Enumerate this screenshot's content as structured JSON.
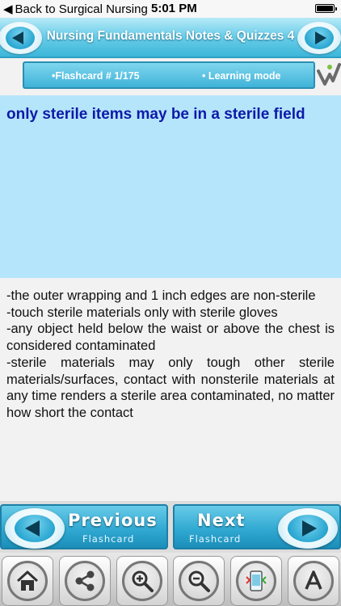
{
  "status_bar": {
    "back_label": "Back to  Surgical Nursing",
    "time": "5:01 PM"
  },
  "header": {
    "title": "Nursing Fundamentals Notes & Quizzes 4"
  },
  "info_bar": {
    "flashcard_label": "•Flashcard #  1/175",
    "mode_label": "• Learning mode"
  },
  "flashcard": {
    "question": "only sterile items may be in a sterile field",
    "answer_lines": [
      "-the outer wrapping and 1 inch edges are non-sterile",
      "-touch sterile materials only with sterile gloves",
      "-any object held below the waist or above the chest is considered contaminated",
      "-sterile materials may only tough other sterile materials/surfaces, contact with nonsterile materials at any time renders a sterile area contaminated, no matter how short the contact"
    ]
  },
  "nav": {
    "previous_title": "Previous",
    "previous_sub": "Flashcard",
    "next_title": "Next",
    "next_sub": "Flashcard"
  },
  "toolbar": {
    "icons": [
      "home-icon",
      "share-icon",
      "zoom-in-icon",
      "zoom-out-icon",
      "flip-card-icon",
      "font-icon"
    ]
  },
  "colors": {
    "accent": "#2ea7d1",
    "question_bg": "#b5e5fa",
    "question_text": "#0d1aa9"
  }
}
